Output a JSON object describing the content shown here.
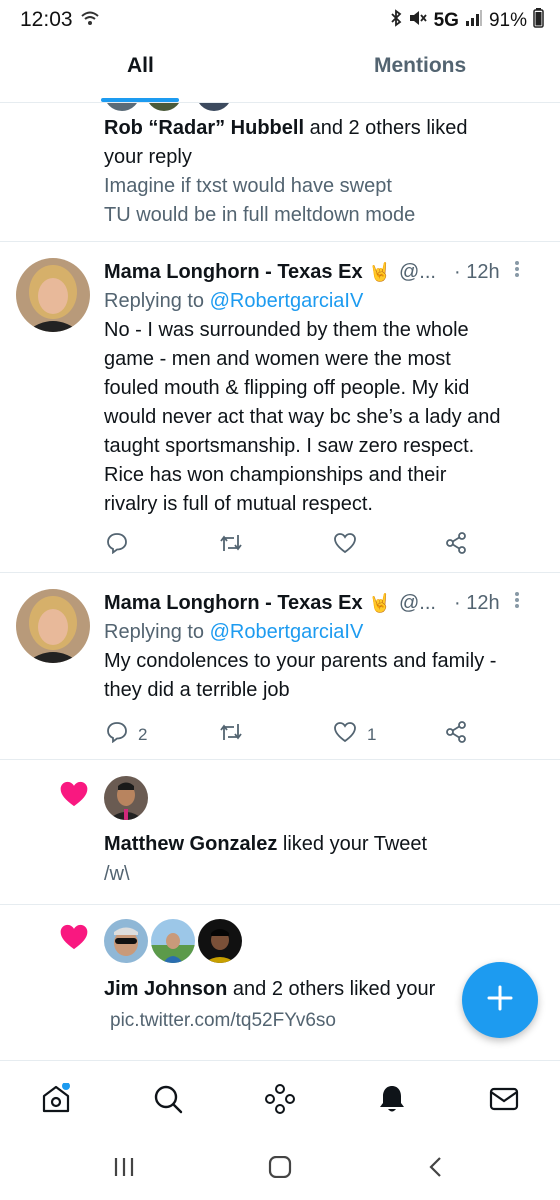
{
  "status_bar": {
    "time": "12:03",
    "network": "5G",
    "battery": "91%"
  },
  "tabs": [
    {
      "label": "All"
    },
    {
      "label": "Mentions"
    }
  ],
  "notifications": [
    {
      "actor": "Rob “Radar” Hubbell",
      "action_text": " and 2 others liked",
      "action_text_2": "your reply",
      "quoted_line_1": "Imagine if txst would have swept",
      "quoted_line_2": "TU would be in full meltdown mode"
    }
  ],
  "tweets": [
    {
      "name": "Mama Longhorn - Texas Ex",
      "handle": "@...",
      "time": "· 12h",
      "replying_prefix": "Replying to ",
      "replying_to": "@RobertgarciaIV",
      "lines": [
        "No - I was surrounded by them the whole",
        "game - men and women were the most",
        "fouled mouth & flipping off people. My kid",
        "would never act that way bc she’s a lady and",
        "taught sportsmanship. I saw zero respect.",
        "Rice has won championships and their",
        "rivalry is full of mutual respect."
      ],
      "reply_count": "",
      "like_count": ""
    },
    {
      "name": "Mama Longhorn - Texas Ex",
      "handle": "@...",
      "time": "· 12h",
      "replying_prefix": "Replying to ",
      "replying_to": "@RobertgarciaIV",
      "lines": [
        "My condolences to your parents and family -",
        "they did a terrible job"
      ],
      "reply_count": "2",
      "like_count": "1"
    }
  ],
  "likes": [
    {
      "actor": "Matthew Gonzalez",
      "action_text": " liked your Tweet",
      "content": "/w\\"
    },
    {
      "actor": "Jim Johnson",
      "action_text": " and 2 others liked your",
      "content": "pic.twitter.com/tq52FYv6so"
    }
  ],
  "icons": {
    "accent": "#1d9bf0",
    "like_heart_color": "#f91880",
    "reply": "reply-icon",
    "retweet": "retweet-icon",
    "like": "heart-icon",
    "share": "share-icon",
    "fab": "compose-plus-icon",
    "nav": [
      "home-icon",
      "search-icon",
      "spaces-icon",
      "notifications-bell-icon",
      "messages-envelope-icon"
    ]
  }
}
